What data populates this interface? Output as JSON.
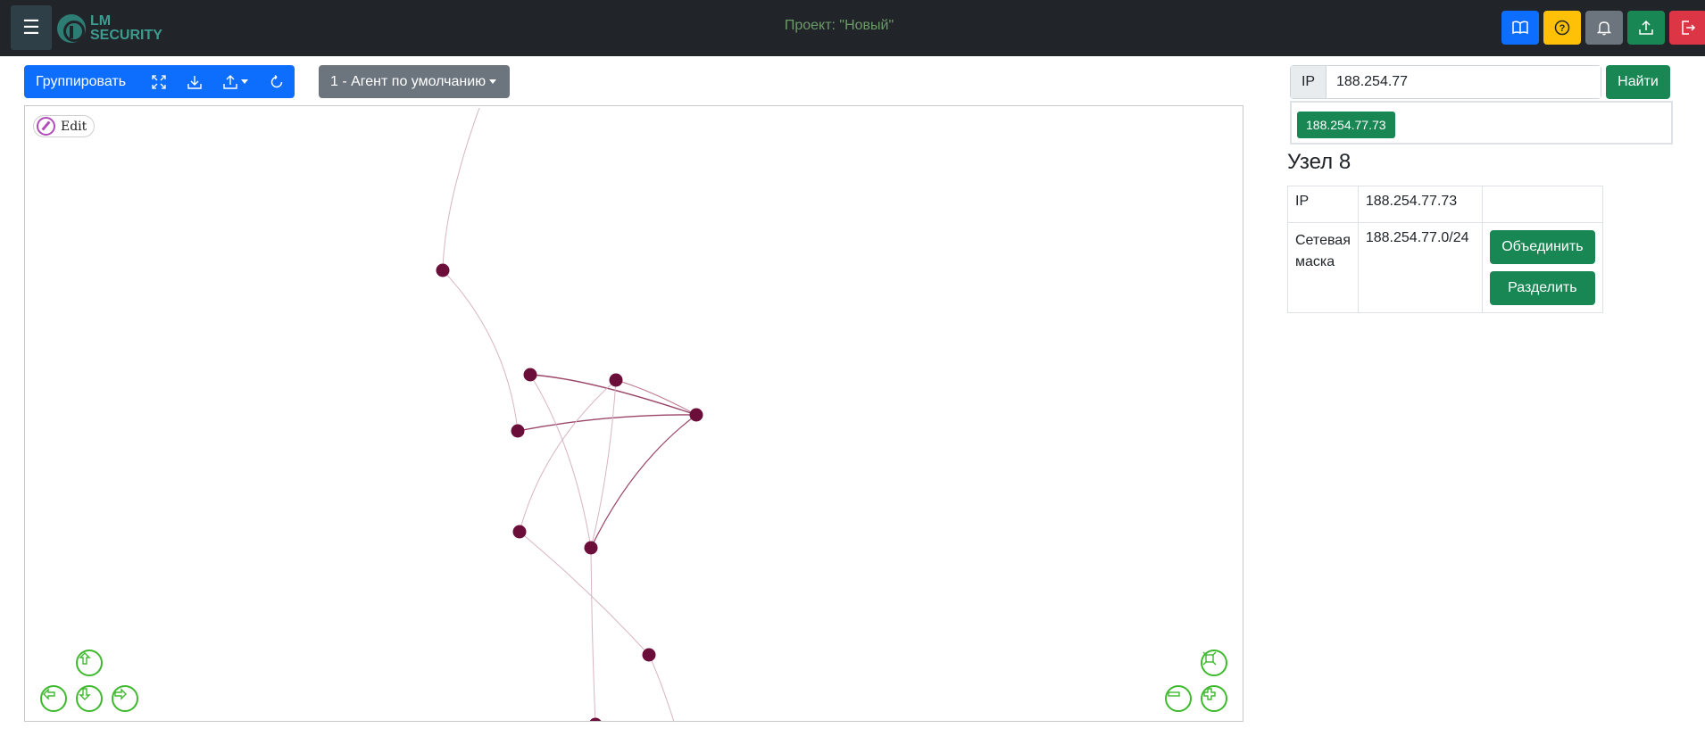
{
  "navbar": {
    "menu_icon": "hamburger-icon",
    "brand_line1": "LM",
    "brand_line2": "SECURITY",
    "project_title": "Проект: \"Новый\"",
    "buttons": [
      {
        "icon": "book-icon",
        "color": "#0d6efd"
      },
      {
        "icon": "help-icon",
        "color": "#ffc107"
      },
      {
        "icon": "bell-icon",
        "color": "#6c757d"
      },
      {
        "icon": "upload-icon",
        "color": "#198754"
      },
      {
        "icon": "logout-icon",
        "color": "#dc3545"
      }
    ]
  },
  "toolbar": {
    "group_label": "Группировать",
    "icons": [
      "fullscreen-icon",
      "download-icon",
      "upload-dropdown-icon",
      "refresh-icon"
    ],
    "agent_label": "1 - Агент по умолчанию"
  },
  "graph": {
    "edit_label": "Edit",
    "node_color": "#6b0f3a",
    "controls": [
      "arrow-up-icon",
      "arrow-left-icon",
      "arrow-down-icon",
      "arrow-right-icon",
      "fit-icon",
      "zoom-out-icon",
      "zoom-in-icon"
    ]
  },
  "search": {
    "prefix": "IP",
    "value": "188.254.77",
    "button": "Найти",
    "suggestion": "188.254.77.73"
  },
  "node": {
    "title": "Узел 8",
    "ip_label": "IP",
    "ip_value": "188.254.77.73",
    "mask_label": "Сетевая маска",
    "mask_value": "188.254.77.0/24",
    "merge_button": "Объединить",
    "split_button": "Разделить"
  }
}
